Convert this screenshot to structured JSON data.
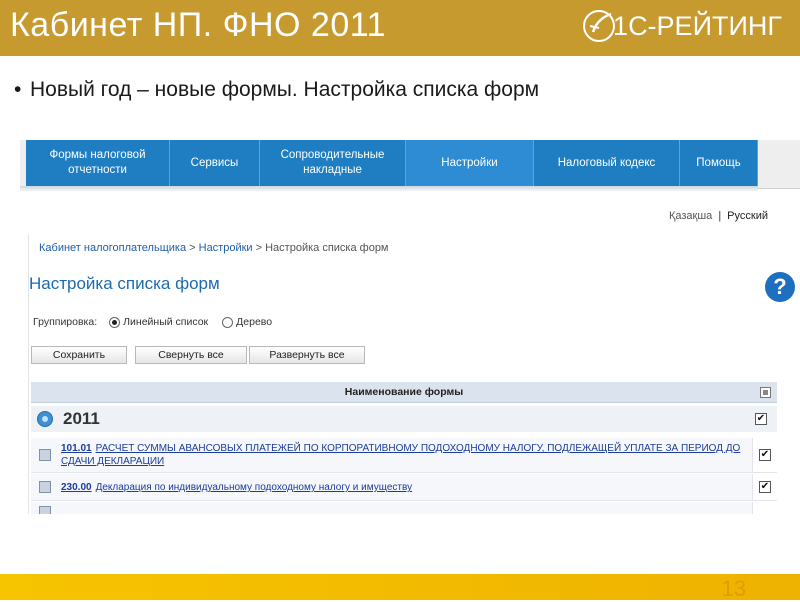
{
  "slide": {
    "title": "Кабинет НП. ФНО 2011",
    "logo_text": "1С-РЕЙТИНГ",
    "bullet": "Новый год – новые формы. Настройка списка форм",
    "page_number": "13"
  },
  "nav": {
    "items": [
      {
        "label": "Формы налоговой отчетности"
      },
      {
        "label": "Сервисы"
      },
      {
        "label": "Сопроводительные накладные"
      },
      {
        "label": "Настройки"
      },
      {
        "label": "Налоговый кодекс"
      },
      {
        "label": "Помощь"
      }
    ]
  },
  "languages": {
    "kazakh": "Қазақша",
    "separator": "|",
    "russian": "Русский"
  },
  "breadcrumb": {
    "root": "Кабинет налогоплательщика",
    "sep": " > ",
    "section": "Настройки",
    "current": "Настройка списка форм"
  },
  "page": {
    "heading": "Настройка списка форм",
    "help_symbol": "?",
    "grouping_label": "Группировка:",
    "grouping_options": [
      {
        "label": "Линейный список",
        "selected": true
      },
      {
        "label": "Дерево",
        "selected": false
      }
    ]
  },
  "buttons": {
    "save": "Сохранить",
    "collapse_all": "Свернуть все",
    "expand_all": "Развернуть все"
  },
  "table": {
    "header": "Наименование формы",
    "group_year": "2011",
    "rows": [
      {
        "code": "101.01",
        "name": "РАСЧЕТ СУММЫ АВАНСОВЫХ ПЛАТЕЖЕЙ ПО КОРПОРАТИВНОМУ ПОДОХОДНОМУ НАЛОГУ, ПОДЛЕЖАЩЕЙ УПЛАТЕ ЗА ПЕРИОД ДО СДАЧИ ДЕКЛАРАЦИИ",
        "checked": true
      },
      {
        "code": "230.00",
        "name": "Декларация по индивидуальному подоходному налогу и имуществу",
        "checked": true
      }
    ]
  },
  "colors": {
    "header_bar": "#c69a2e",
    "nav_blue": "#1f7dc2",
    "footer_yellow": "#f7c400",
    "page_number": "#e39b00"
  }
}
